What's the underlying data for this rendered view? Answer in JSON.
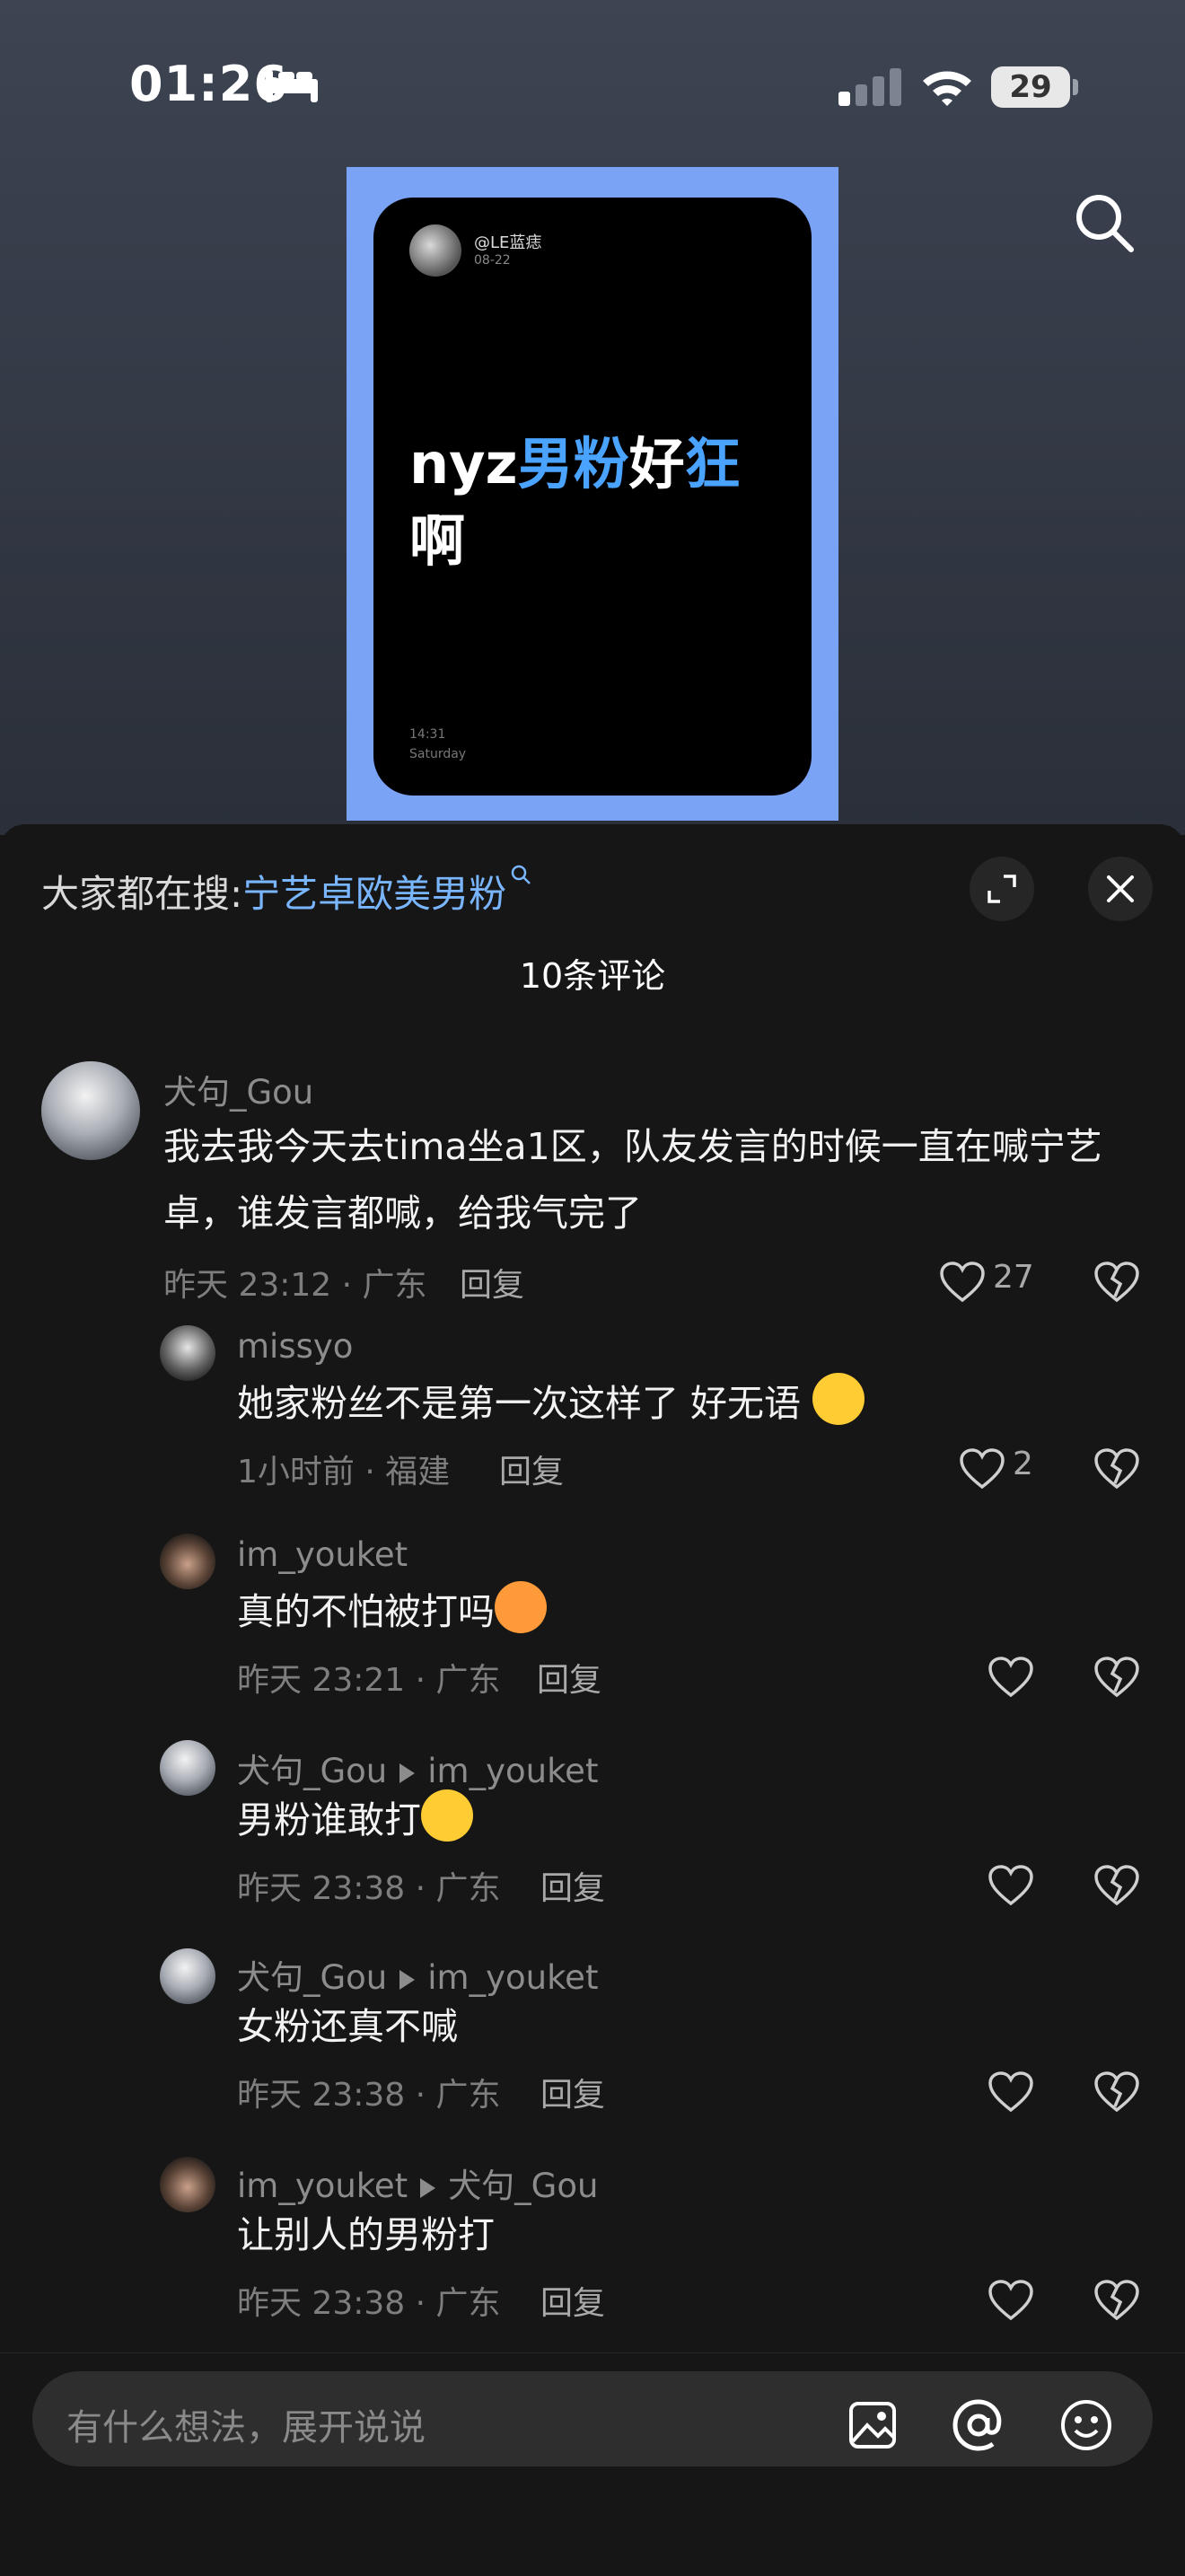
{
  "status": {
    "time": "01:26",
    "battery": "29"
  },
  "post": {
    "handle": "@LE蓝痣",
    "date": "08-22",
    "headline_parts": [
      "nyz",
      "男粉",
      "好",
      "狂",
      "啊"
    ],
    "clock": "14:31",
    "weekday": "Saturday"
  },
  "sheet": {
    "trend_label": "大家都在搜:",
    "trend_keyword": "宁艺卓欧美男粉",
    "count": "10条评论",
    "reply_label": "回复",
    "comments": [
      {
        "user": "犬句_Gou",
        "text": "我去我今天去tima坐a1区，队友发言的时候一直在喊宁艺卓，谁发言都喊，给我气完了",
        "meta": "昨天 23:12 · 广东",
        "likes": "27"
      },
      {
        "user": "missyo",
        "text": "她家粉丝不是第一次这样了 好无语",
        "meta": "1小时前 · 福建",
        "likes": "2"
      },
      {
        "user": "im_youket",
        "text": "真的不怕被打吗",
        "meta": "昨天 23:21 · 广东",
        "likes": ""
      },
      {
        "user": "犬句_Gou",
        "reply_to": "im_youket",
        "text": "男粉谁敢打",
        "meta": "昨天 23:38 · 广东",
        "likes": ""
      },
      {
        "user": "犬句_Gou",
        "reply_to": "im_youket",
        "text": "女粉还真不喊",
        "meta": "昨天 23:38 · 广东",
        "likes": ""
      },
      {
        "user": "im_youket",
        "reply_to": "犬句_Gou",
        "text": "让别人的男粉打",
        "meta": "昨天 23:38 · 广东",
        "likes": ""
      }
    ]
  },
  "input": {
    "placeholder": "有什么想法，展开说说"
  },
  "icons": [
    "sleep-icon",
    "signal-icon",
    "wifi-icon",
    "battery-icon",
    "search-icon",
    "expand-icon",
    "close-icon",
    "like-icon",
    "dislike-icon",
    "image-icon",
    "at-icon",
    "emoji-icon"
  ]
}
